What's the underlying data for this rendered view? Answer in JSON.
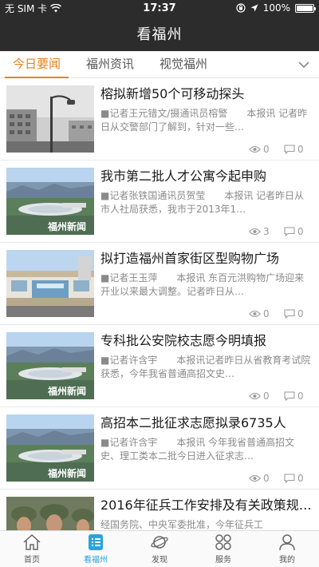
{
  "status_bar": {
    "carrier": "无 SIM 卡",
    "time": "17:37",
    "battery": "100%"
  },
  "nav": {
    "title": "看福州"
  },
  "tabs": [
    {
      "label": "今日要闻",
      "active": true
    },
    {
      "label": "福州资讯",
      "active": false
    },
    {
      "label": "视觉福州",
      "active": false
    }
  ],
  "news": [
    {
      "title": "榕拟新增50个可移动探头",
      "summary": "■记者王元错文/摄通讯员榕警　　本报讯 记者昨日从交警部门了解到，针对一些…",
      "views": "0",
      "comments": "0",
      "thumb": "street"
    },
    {
      "title": "我市第二批人才公寓今起申购",
      "summary": "■记者张铁国通讯员贺莹　　本报讯 记者昨日从市人社局获悉，我市于2013年1…",
      "views": "3",
      "comments": "0",
      "thumb": "stadium",
      "thumb_caption": "福州新闻"
    },
    {
      "title": "拟打造福州首家街区型购物广场",
      "summary": "■记者王玉萍　　本报讯 东百元洪购物广场迎来开业以来最大调整。记者昨日从…",
      "views": "0",
      "comments": "0",
      "thumb": "mall"
    },
    {
      "title": "专科批公安院校志愿今明填报",
      "summary": "■记者许含宇　　本报讯记者昨日从省教育考试院获悉，今年我省普通高招文史…",
      "views": "0",
      "comments": "0",
      "thumb": "stadium",
      "thumb_caption": "福州新闻"
    },
    {
      "title": "高招本二批征求志愿拟录6735人",
      "summary": "■记者许含宇　　本报讯 今年我省普通高招文史、理工类本二批今日进入征求志…",
      "views": "0",
      "comments": "0",
      "thumb": "stadium",
      "thumb_caption": "福州新闻"
    },
    {
      "title": "2016年征兵工作安排及有关政策规…",
      "summary": "经国务院、中央军委批准，今年征兵工",
      "views": "",
      "comments": "",
      "thumb": "soldiers"
    }
  ],
  "bottom_tabs": [
    {
      "label": "首页",
      "icon": "home-icon",
      "active": false
    },
    {
      "label": "看福州",
      "icon": "list-icon",
      "active": true
    },
    {
      "label": "发现",
      "icon": "planet-icon",
      "active": false
    },
    {
      "label": "服务",
      "icon": "grid-icon",
      "active": false
    },
    {
      "label": "我的",
      "icon": "user-icon",
      "active": false
    }
  ],
  "colors": {
    "header_bg": "#2c2c2c",
    "tab_accent": "#e8801c",
    "bottom_active": "#29a4dc"
  }
}
